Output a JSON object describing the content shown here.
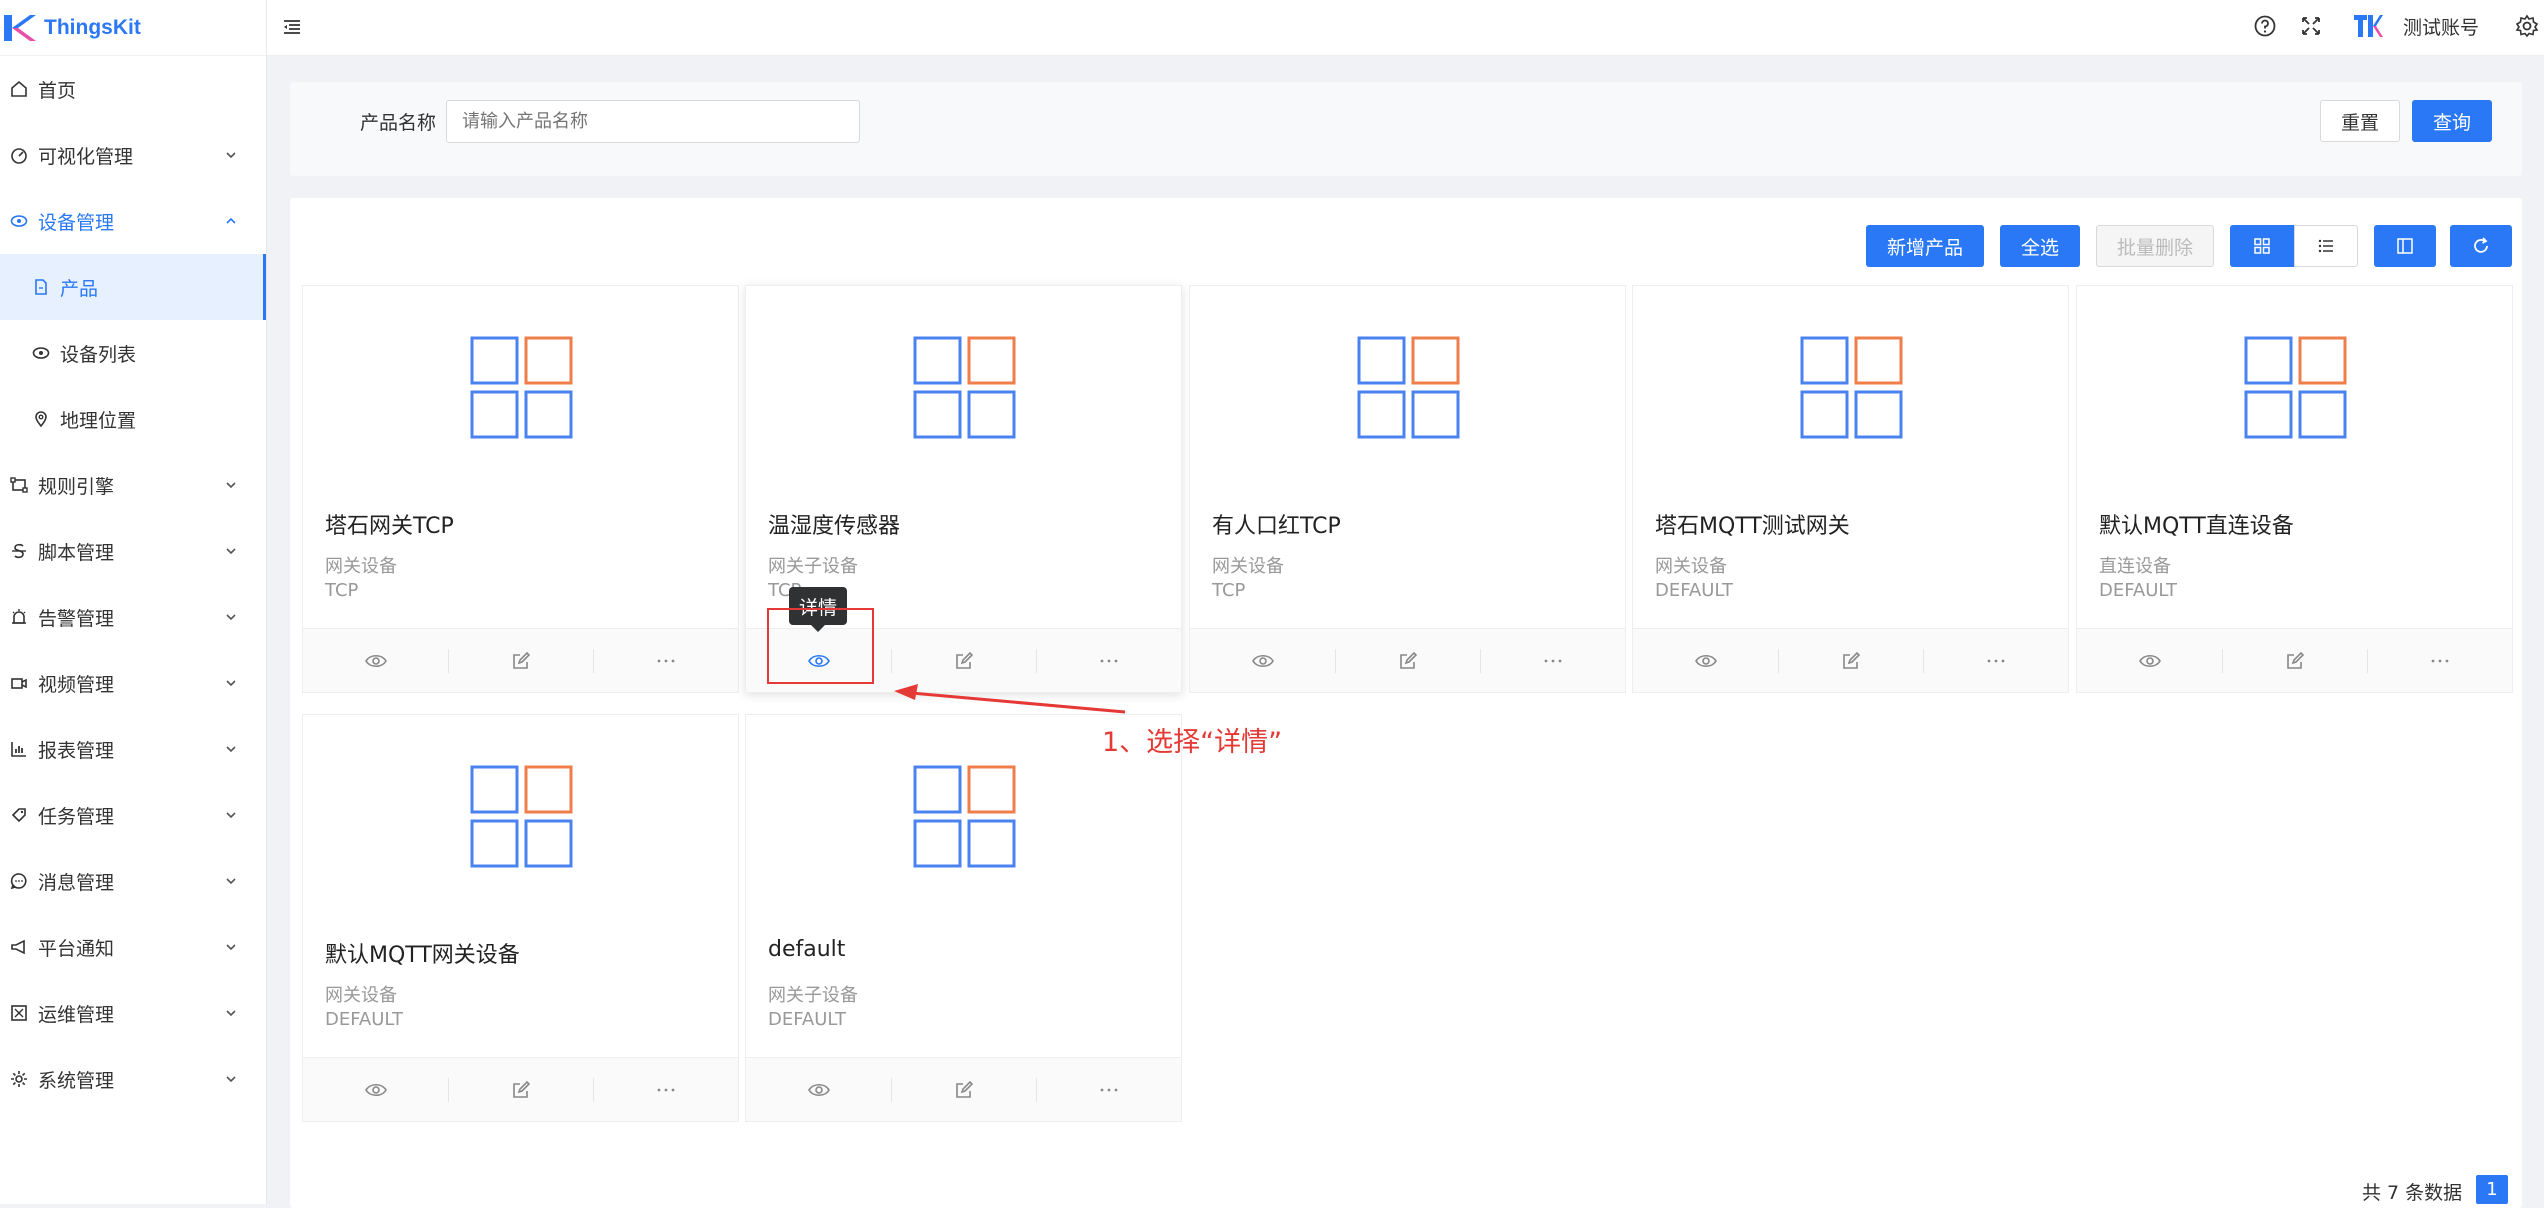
{
  "app": {
    "name": "ThingsKit"
  },
  "sidebar": {
    "items": [
      {
        "label": "首页",
        "icon": "home-icon"
      },
      {
        "label": "可视化管理",
        "icon": "dashboard-icon"
      },
      {
        "label": "设备管理",
        "icon": "device-icon",
        "open": true
      },
      {
        "label": "产品",
        "icon": "document-icon",
        "sub": true,
        "active": true
      },
      {
        "label": "设备列表",
        "icon": "device-list-icon",
        "sub": true
      },
      {
        "label": "地理位置",
        "icon": "location-icon",
        "sub": true
      },
      {
        "label": "规则引擎",
        "icon": "rule-icon"
      },
      {
        "label": "脚本管理",
        "icon": "script-icon"
      },
      {
        "label": "告警管理",
        "icon": "alarm-icon"
      },
      {
        "label": "视频管理",
        "icon": "video-icon"
      },
      {
        "label": "报表管理",
        "icon": "report-icon"
      },
      {
        "label": "任务管理",
        "icon": "task-icon"
      },
      {
        "label": "消息管理",
        "icon": "message-icon"
      },
      {
        "label": "平台通知",
        "icon": "notice-icon"
      },
      {
        "label": "运维管理",
        "icon": "ops-icon"
      },
      {
        "label": "系统管理",
        "icon": "system-icon"
      }
    ]
  },
  "header": {
    "account": "测试账号"
  },
  "search": {
    "label": "产品名称",
    "placeholder": "请输入产品名称",
    "reset": "重置",
    "query": "查询"
  },
  "toolbar": {
    "add": "新增产品",
    "select_all": "全选",
    "batch_delete": "批量删除"
  },
  "cards": [
    {
      "name": "塔石网关TCP",
      "type": "网关设备",
      "protocol": "TCP"
    },
    {
      "name": "温湿度传感器",
      "type": "网关子设备",
      "protocol": "TCP"
    },
    {
      "name": "有人口红TCP",
      "type": "网关设备",
      "protocol": "TCP"
    },
    {
      "name": "塔石MQTT测试网关",
      "type": "网关设备",
      "protocol": "DEFAULT"
    },
    {
      "name": "默认MQTT直连设备",
      "type": "直连设备",
      "protocol": "DEFAULT"
    },
    {
      "name": "默认MQTT网关设备",
      "type": "网关设备",
      "protocol": "DEFAULT"
    },
    {
      "name": "default",
      "type": "网关子设备",
      "protocol": "DEFAULT"
    }
  ],
  "tooltip": "详情",
  "annotation": "1、选择“详情”",
  "pagination": {
    "total": "共 7 条数据",
    "page": "1"
  },
  "colors": {
    "primary": "#2a78f6",
    "orange": "#f07e4b",
    "annotation_red": "#e53935"
  }
}
